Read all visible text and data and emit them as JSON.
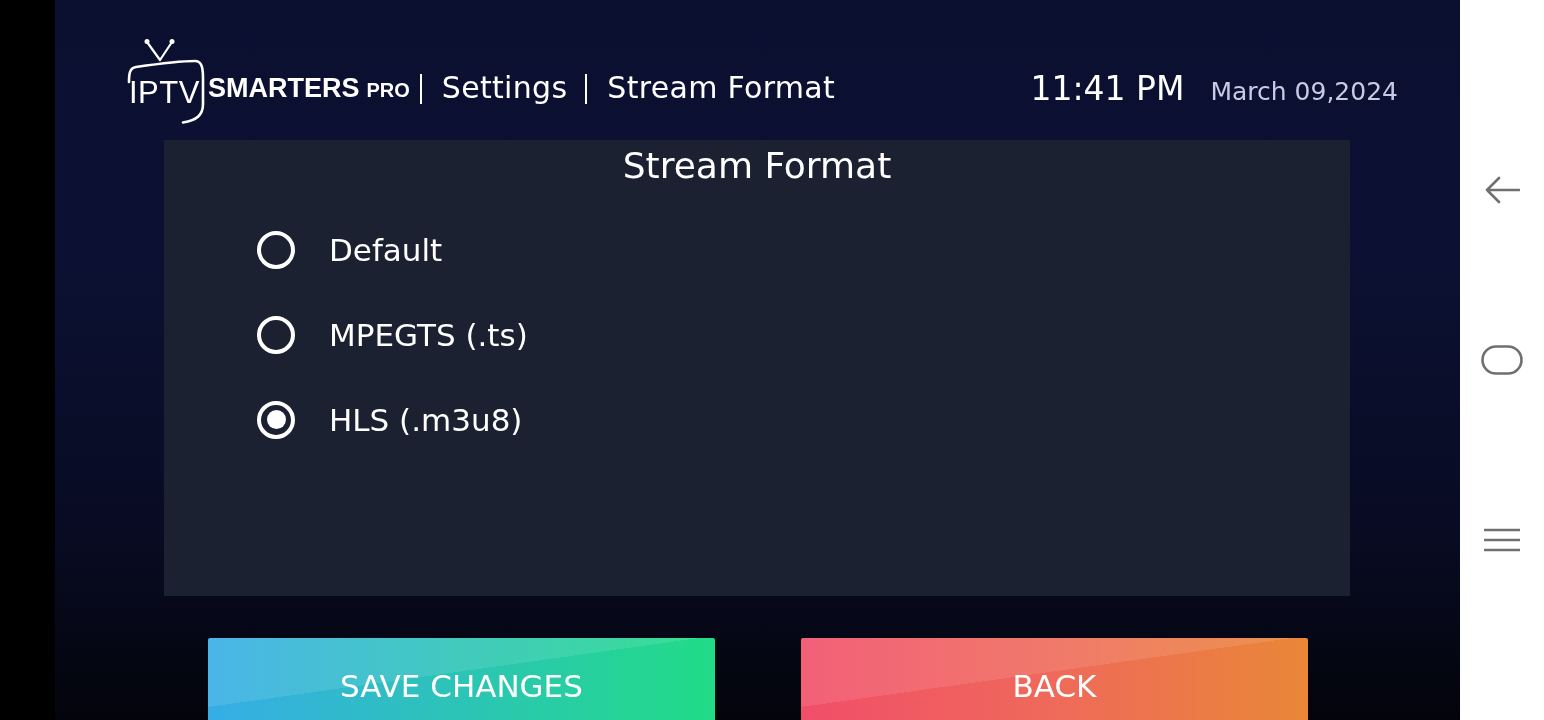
{
  "header": {
    "logo": {
      "iptv": "IPTV",
      "brand": "SMARTERS",
      "suffix": "PRO"
    },
    "breadcrumbs": [
      {
        "label": "Settings"
      },
      {
        "label": "Stream Format"
      }
    ],
    "time": "11:41 PM",
    "date": "March 09,2024"
  },
  "panel": {
    "title": "Stream Format",
    "options": [
      {
        "label": "Default",
        "selected": false
      },
      {
        "label": "MPEGTS (.ts)",
        "selected": false
      },
      {
        "label": "HLS (.m3u8)",
        "selected": true
      }
    ]
  },
  "buttons": [
    {
      "label": "SAVE CHANGES",
      "kind": "save"
    },
    {
      "label": "BACK",
      "kind": "back"
    }
  ]
}
